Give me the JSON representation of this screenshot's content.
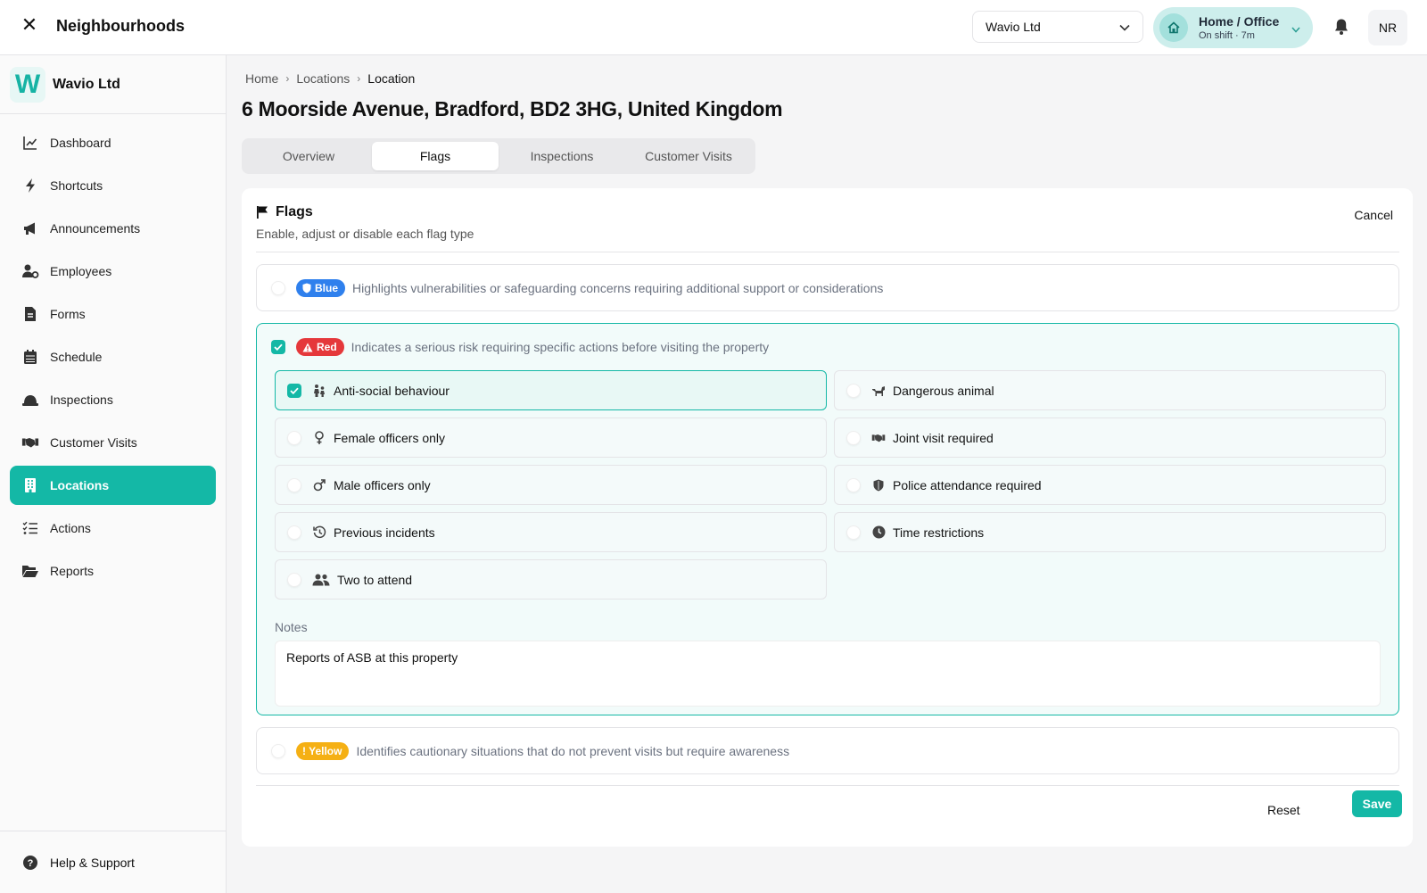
{
  "topbar": {
    "title": "Neighbourhoods",
    "org_select_value": "Wavio Ltd",
    "shift_title": "Home / Office",
    "shift_sub": "On shift · 7m",
    "avatar_initials": "NR"
  },
  "sidebar": {
    "brand_logo": "W",
    "brand_name": "Wavio Ltd",
    "items": [
      {
        "label": "Dashboard",
        "icon": "chart-line-icon"
      },
      {
        "label": "Shortcuts",
        "icon": "bolt-icon"
      },
      {
        "label": "Announcements",
        "icon": "megaphone-icon"
      },
      {
        "label": "Employees",
        "icon": "users-gear-icon"
      },
      {
        "label": "Forms",
        "icon": "file-icon"
      },
      {
        "label": "Schedule",
        "icon": "calendar-icon"
      },
      {
        "label": "Inspections",
        "icon": "hard-hat-icon"
      },
      {
        "label": "Customer Visits",
        "icon": "handshake-icon"
      },
      {
        "label": "Locations",
        "icon": "building-icon",
        "active": true
      },
      {
        "label": "Actions",
        "icon": "list-check-icon"
      },
      {
        "label": "Reports",
        "icon": "folder-open-icon"
      }
    ],
    "help_label": "Help & Support"
  },
  "breadcrumb": {
    "items": [
      "Home",
      "Locations"
    ],
    "current": "Location"
  },
  "page_title": "6 Moorside Avenue, Bradford, BD2 3HG, United Kingdom",
  "tabs": [
    {
      "label": "Overview"
    },
    {
      "label": "Flags",
      "active": true
    },
    {
      "label": "Inspections"
    },
    {
      "label": "Customer Visits"
    }
  ],
  "flags_card": {
    "title": "Flags",
    "subtitle": "Enable, adjust or disable each flag type",
    "cancel_label": "Cancel",
    "reset_label": "Reset",
    "save_label": "Save",
    "blue": {
      "badge": "Blue",
      "description": "Highlights vulnerabilities or safeguarding concerns requiring additional support or considerations",
      "color": "#2f80ed",
      "enabled": false
    },
    "red": {
      "badge": "Red",
      "description": "Indicates a serious risk requiring specific actions before visiting the property",
      "color": "#e5383b",
      "enabled": true,
      "options": [
        {
          "label": "Anti-social behaviour",
          "icon": "people-arguing-icon",
          "checked": true
        },
        {
          "label": "Dangerous animal",
          "icon": "dog-icon",
          "checked": false
        },
        {
          "label": "Female officers only",
          "icon": "venus-icon",
          "checked": false
        },
        {
          "label": "Joint visit required",
          "icon": "handshake-icon",
          "checked": false
        },
        {
          "label": "Male officers only",
          "icon": "mars-icon",
          "checked": false
        },
        {
          "label": "Police attendance required",
          "icon": "shield-icon",
          "checked": false
        },
        {
          "label": "Previous incidents",
          "icon": "history-icon",
          "checked": false
        },
        {
          "label": "Time restrictions",
          "icon": "clock-icon",
          "checked": false
        },
        {
          "label": "Two to attend",
          "icon": "user-group-icon",
          "checked": false
        }
      ],
      "notes_label": "Notes",
      "notes_value": "Reports of ASB at this property"
    },
    "yellow": {
      "badge": "! Yellow",
      "description": "Identifies cautionary situations that do not prevent visits but require awareness",
      "color": "#f5b014",
      "enabled": false
    }
  },
  "colors": {
    "accent": "#14b8a6",
    "accent_light": "#f2fbfa"
  }
}
